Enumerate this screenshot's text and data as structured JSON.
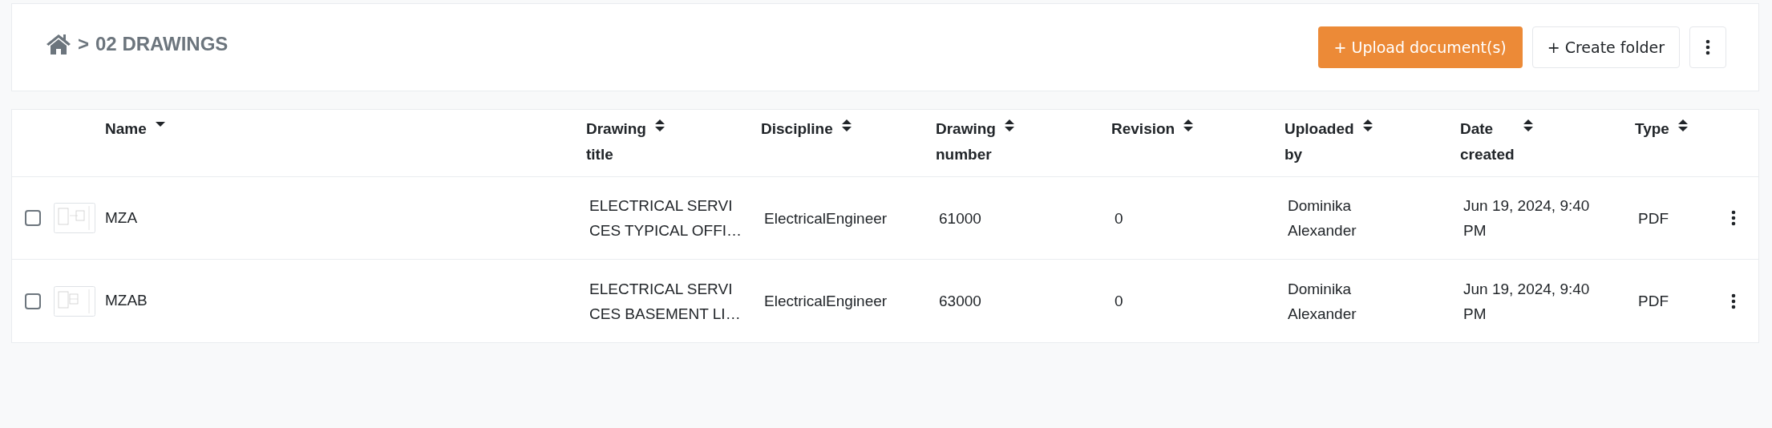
{
  "breadcrumb": {
    "separator": ">",
    "current": "02 DRAWINGS"
  },
  "actions": [
    {
      "kind": "primary",
      "icon": "+",
      "label": "Upload document(s)"
    },
    {
      "kind": "secondary",
      "icon": "+",
      "label": "Create folder"
    },
    {
      "kind": "more"
    }
  ],
  "table": {
    "columns": [
      {
        "label": "Name",
        "sorted": true
      },
      {
        "label": "Drawing title",
        "sorted": false
      },
      {
        "label": "Discipline",
        "sorted": false
      },
      {
        "label": "Drawing number",
        "sorted": false
      },
      {
        "label": "Revision",
        "sorted": false
      },
      {
        "label": "Uploaded by",
        "sorted": false
      },
      {
        "label": "Date created",
        "sorted": false
      },
      {
        "label": "Type",
        "sorted": false
      }
    ],
    "rows": [
      {
        "checked": false,
        "name": "MZA",
        "drawing_title": [
          "ELECTRICAL SERVI",
          "CES TYPICAL OFFI…"
        ],
        "discipline": "ElectricalEngineer",
        "drawing_number": "61000",
        "revision": "0",
        "uploaded_by": "Dominika Alexander",
        "date_created": "Jun 19, 2024, 9:40 PM",
        "type": "PDF"
      },
      {
        "checked": false,
        "name": "MZAB",
        "drawing_title": [
          "ELECTRICAL SERVI",
          "CES BASEMENT LI…"
        ],
        "discipline": "ElectricalEngineer",
        "drawing_number": "63000",
        "revision": "0",
        "uploaded_by": "Dominika Alexander",
        "date_created": "Jun 19, 2024, 9:40 PM",
        "type": "PDF"
      }
    ]
  }
}
